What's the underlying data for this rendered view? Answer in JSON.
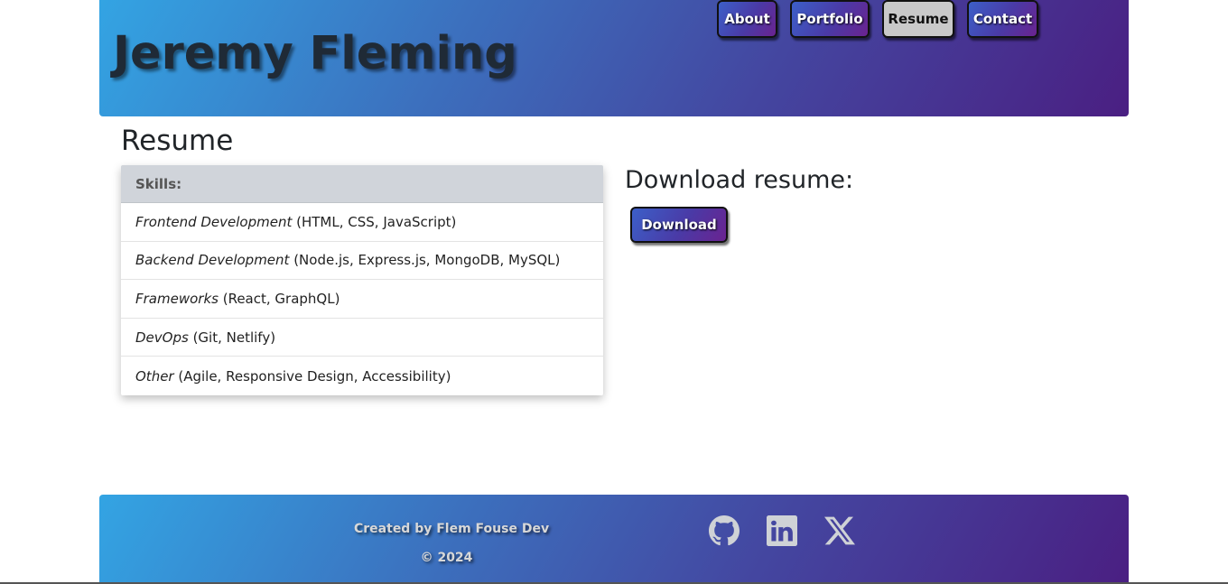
{
  "header": {
    "title": "Jeremy Fleming",
    "nav": [
      {
        "label": "About",
        "active": false
      },
      {
        "label": "Portfolio",
        "active": false
      },
      {
        "label": "Resume",
        "active": true
      },
      {
        "label": "Contact",
        "active": false
      }
    ]
  },
  "main": {
    "heading": "Resume",
    "skills_header": "Skills:",
    "skills": [
      {
        "name": "Frontend Development",
        "detail": " (HTML, CSS, JavaScript)"
      },
      {
        "name": "Backend Development",
        "detail": " (Node.js, Express.js, MongoDB, MySQL)"
      },
      {
        "name": "Frameworks",
        "detail": " (React, GraphQL)"
      },
      {
        "name": "DevOps",
        "detail": " (Git, Netlify)"
      },
      {
        "name": "Other",
        "detail": " (Agile, Responsive Design, Accessibility)"
      }
    ],
    "download_title": "Download resume:",
    "download_label": "Download"
  },
  "footer": {
    "credit": "Created by Flem Fouse Dev",
    "copyright": "© 2024",
    "social": [
      {
        "icon": "github-icon"
      },
      {
        "icon": "linkedin-icon"
      },
      {
        "icon": "x-icon"
      }
    ]
  },
  "colors": {
    "gradient_start": "#33a4e3",
    "gradient_end": "#4a1f82",
    "active_nav": "#c9c9c9",
    "skills_header_bg": "#d0d4da"
  }
}
